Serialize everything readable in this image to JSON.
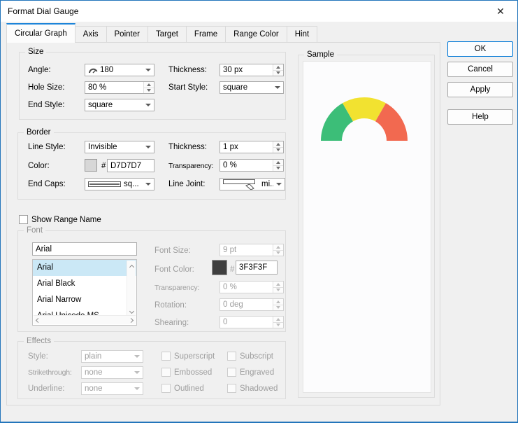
{
  "window": {
    "title": "Format Dial Gauge",
    "close_icon": "✕"
  },
  "tabs": [
    {
      "label": "Circular Graph",
      "active": true
    },
    {
      "label": "Axis",
      "active": false
    },
    {
      "label": "Pointer",
      "active": false
    },
    {
      "label": "Target",
      "active": false
    },
    {
      "label": "Frame",
      "active": false
    },
    {
      "label": "Range Color",
      "active": false
    },
    {
      "label": "Hint",
      "active": false
    }
  ],
  "size": {
    "legend": "Size",
    "angle_label": "Angle:",
    "angle_value": "180",
    "thickness_label": "Thickness:",
    "thickness_value": "30 px",
    "hole_size_label": "Hole Size:",
    "hole_size_value": "80 %",
    "start_style_label": "Start Style:",
    "start_style_value": "square",
    "end_style_label": "End Style:",
    "end_style_value": "square"
  },
  "border": {
    "legend": "Border",
    "line_style_label": "Line Style:",
    "line_style_value": "Invisible",
    "thickness_label": "Thickness:",
    "thickness_value": "1 px",
    "color_label": "Color:",
    "color_hash": "#",
    "color_hex": "D7D7D7",
    "color_swatch": "#D7D7D7",
    "transparency_label": "Transparency:",
    "transparency_value": "0 %",
    "end_caps_label": "End Caps:",
    "end_caps_value": "sq...",
    "line_joint_label": "Line Joint:",
    "line_joint_value": "mi..."
  },
  "range_name": {
    "label": "Show Range Name",
    "checked": false
  },
  "font": {
    "legend": "Font",
    "name_value": "Arial",
    "list": [
      "Arial",
      "Arial Black",
      "Arial Narrow",
      "Arial Unicode MS"
    ],
    "selected": "Arial",
    "font_size_label": "Font Size:",
    "font_size_value": "9 pt",
    "font_color_label": "Font Color:",
    "font_color_hash": "#",
    "font_color_hex": "3F3F3F",
    "font_color_swatch": "#3F3F3F",
    "transparency_label": "Transparency:",
    "transparency_value": "0 %",
    "rotation_label": "Rotation:",
    "rotation_value": "0 deg",
    "shearing_label": "Shearing:",
    "shearing_value": "0"
  },
  "effects": {
    "legend": "Effects",
    "style_label": "Style:",
    "style_value": "plain",
    "strikethrough_label": "Strikethrough:",
    "strikethrough_value": "none",
    "underline_label": "Underline:",
    "underline_value": "none",
    "checks": [
      "Superscript",
      "Subscript",
      "Embossed",
      "Engraved",
      "Outlined",
      "Shadowed"
    ]
  },
  "sample": {
    "legend": "Sample",
    "gauge": {
      "type": "dial",
      "angle": 180,
      "segments": [
        "#3CBE78",
        "#F2E230",
        "#F26950"
      ]
    }
  },
  "buttons": {
    "ok": "OK",
    "cancel": "Cancel",
    "apply": "Apply",
    "help": "Help"
  },
  "colors": {
    "accent": "#0078D7",
    "tab_highlight": "#1C84D9",
    "selection": "#CBE8F6"
  }
}
